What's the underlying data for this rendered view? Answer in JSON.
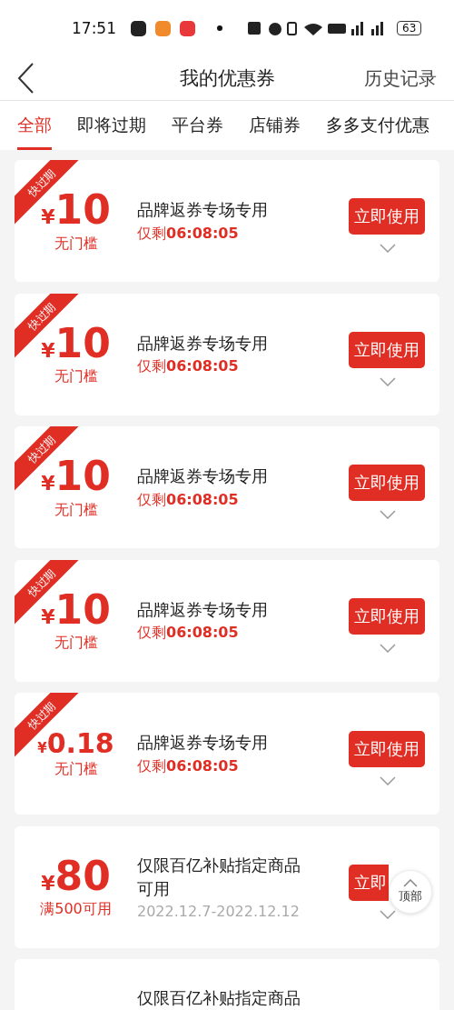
{
  "status_bar": {
    "time": "17:51",
    "battery": "63"
  },
  "header": {
    "title": "我的优惠券",
    "action": "历史记录"
  },
  "tabs": [
    {
      "label": "全部",
      "selected": true
    },
    {
      "label": "即将过期",
      "selected": false
    },
    {
      "label": "平台券",
      "selected": false
    },
    {
      "label": "店铺券",
      "selected": false
    },
    {
      "label": "多多支付优惠",
      "selected": false
    }
  ],
  "coupons": [
    {
      "ribbon": "快过期",
      "currency": "¥",
      "amount": "10",
      "condition": "无门槛",
      "title": "品牌返券专场专用",
      "detail": {
        "kind": "countdown",
        "text": "仅剩**06:08:05**"
      },
      "button": "立即使用"
    },
    {
      "ribbon": "快过期",
      "currency": "¥",
      "amount": "10",
      "condition": "无门槛",
      "title": "品牌返券专场专用",
      "detail": {
        "kind": "countdown",
        "text": "仅剩**06:08:05**"
      },
      "button": "立即使用"
    },
    {
      "ribbon": "快过期",
      "currency": "¥",
      "amount": "10",
      "condition": "无门槛",
      "title": "品牌返券专场专用",
      "detail": {
        "kind": "countdown",
        "text": "仅剩**06:08:05**"
      },
      "button": "立即使用"
    },
    {
      "ribbon": "快过期",
      "currency": "¥",
      "amount": "10",
      "condition": "无门槛",
      "title": "品牌返券专场专用",
      "detail": {
        "kind": "countdown",
        "text": "仅剩**06:08:05**"
      },
      "button": "立即使用"
    },
    {
      "ribbon": "快过期",
      "currency": "¥",
      "amount": "0.18",
      "condition": "无门槛",
      "title": "品牌返券专场专用",
      "detail": {
        "kind": "countdown",
        "text": "仅剩**06:08:05**"
      },
      "button": "立即使用"
    },
    {
      "currency": "¥",
      "amount": "80",
      "condition": "满500可用",
      "title": "仅限百亿补贴指定商品可用",
      "detail": {
        "kind": "date",
        "text": "2022.12.7-2022.12.12"
      },
      "button": "立即"
    },
    {
      "title": "仅限百亿补贴指定商品"
    }
  ],
  "float_button": {
    "label": "顶部"
  }
}
